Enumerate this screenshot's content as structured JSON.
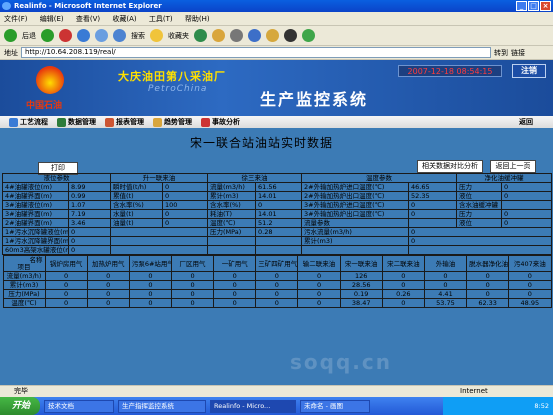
{
  "window": {
    "title": "Realinfo - Microsoft Internet Explorer"
  },
  "menu": [
    "文件(F)",
    "编辑(E)",
    "查看(V)",
    "收藏(A)",
    "工具(T)",
    "帮助(H)"
  ],
  "toolbar": {
    "back": "后退",
    "search": "搜索",
    "favorites": "收藏夹",
    "goto": "转到",
    "links": "链接"
  },
  "address": {
    "url": "http://10.64.208.119/real/"
  },
  "banner": {
    "company": "大庆油田第八采油厂",
    "watermark": "PetroChina",
    "system": "生产监控系统",
    "logo_text": "中国石油",
    "datetime": "2007-12-18 08:54:15",
    "logout": "注销"
  },
  "nav": {
    "items": [
      "工艺流程",
      "数据管理",
      "报表管理",
      "趋势管理",
      "事故分析"
    ],
    "back": "返回"
  },
  "page": {
    "heading": "宋一联合站油站实时数据",
    "print": "打印",
    "compare": "相关数据对比分析",
    "prev": "返回上一页"
  },
  "table": {
    "header": [
      "液位参数",
      "升一联来油",
      "徐三来油",
      "温度参数",
      "净化油缓冲罐"
    ],
    "rows": [
      [
        "4#油罐液位(m)",
        "8.99",
        "瞬时值(t/h)",
        "0",
        "流量(m3/h)",
        "61.56",
        "2#外输加热炉进口温度(℃)",
        "46.65",
        "压力",
        "0"
      ],
      [
        "4#油罐界面(m)",
        "0.99",
        "累值(t)",
        "0",
        "累计(m3)",
        "14.01",
        "2#外输加热炉出口温度(℃)",
        "52.35",
        "液位",
        "0"
      ],
      [
        "3#油罐液位(m)",
        "1.07",
        "含水率(%)",
        "100",
        "含水率(%)",
        "0",
        "3#外输加热炉进口温度(℃)",
        "0",
        "含水油缓冲罐",
        ""
      ],
      [
        "3#油罐界面(m)",
        "7.19",
        "水量(t)",
        "0",
        "耗油(T)",
        "14.01",
        "3#外输加热炉出口温度(℃)",
        "0",
        "压力",
        "0"
      ],
      [
        "2#油罐界面(m)",
        "3.46",
        "油量(t)",
        "0",
        "温度(℃)",
        "51.2",
        "流量参数",
        "",
        "液位",
        "0"
      ]
    ],
    "extra_rows": [
      [
        "1#污水沉降罐液位(m)",
        "0",
        "压力(MPa)",
        "0.28",
        "污水流量(m3/h)",
        "0"
      ],
      [
        "1#污水沉降罐界面(m)",
        "0",
        "",
        "",
        "累计(m3)",
        "0"
      ],
      [
        "60m3高架水罐液位(m)",
        "0",
        "",
        "",
        "",
        ""
      ]
    ],
    "lower_header": {
      "corner_top": "名称",
      "corner_bottom": "项目",
      "cols": [
        "锅炉房用气",
        "加热炉用气",
        "污泵6#站用气",
        "厂区用气",
        "一矿用气",
        "三矿四矿用气",
        "输二联来油",
        "宋一联来油",
        "宋二联来油",
        "外输油",
        "脱水器净化油",
        "污407来油"
      ]
    },
    "lower_rows": [
      {
        "label": "流量(m3/h)",
        "values": [
          "0",
          "0",
          "0",
          "0",
          "0",
          "0",
          "0",
          "126",
          "0",
          "0",
          "0",
          "0"
        ]
      },
      {
        "label": "累计(m3)",
        "values": [
          "0",
          "0",
          "0",
          "0",
          "0",
          "0",
          "0",
          "28.56",
          "0",
          "0",
          "0",
          "0"
        ]
      },
      {
        "label": "压力(MPa)",
        "values": [
          "0",
          "0",
          "0",
          "0",
          "0",
          "0",
          "0",
          "0.19",
          "0.26",
          "4.41",
          "0",
          "0"
        ]
      },
      {
        "label": "温度(℃)",
        "values": [
          "0",
          "0",
          "0",
          "0",
          "0",
          "0",
          "0",
          "38.47",
          "0",
          "53.75",
          "62.33",
          "48.95"
        ]
      }
    ]
  },
  "status": {
    "left": "完毕",
    "zone": "Internet"
  },
  "taskbar": {
    "start": "开始",
    "tasks": [
      "技术文档",
      "生产指挥监控系统",
      "Realinfo - Micro...",
      "未命名 - 画图"
    ],
    "tray": "8:52"
  }
}
